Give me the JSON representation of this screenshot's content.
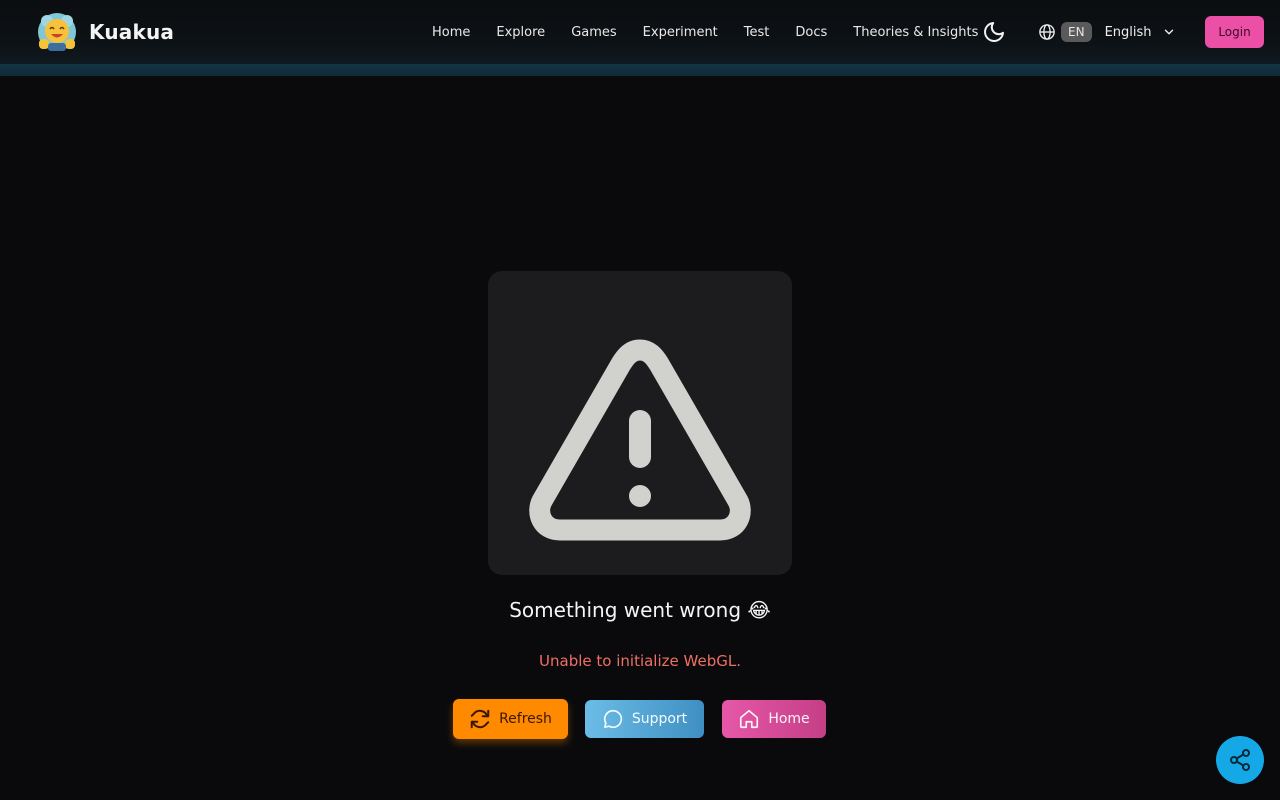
{
  "brand": {
    "name": "Kuakua",
    "logo_icon": "mascot-logo-icon"
  },
  "nav": {
    "items": [
      {
        "label": "Home"
      },
      {
        "label": "Explore"
      },
      {
        "label": "Games"
      },
      {
        "label": "Experiment"
      },
      {
        "label": "Test"
      },
      {
        "label": "Docs"
      },
      {
        "label": "Theories & Insights"
      }
    ]
  },
  "header": {
    "theme_icon": "moon-icon",
    "language": {
      "code": "EN",
      "name": "English",
      "icon": "globe-icon"
    },
    "login_label": "Login"
  },
  "error": {
    "icon": "warning-triangle-icon",
    "title": "Something went wrong 😂",
    "message": "Unable to initialize WebGL."
  },
  "actions": {
    "refresh_label": "Refresh",
    "support_label": "Support",
    "home_label": "Home"
  },
  "share_icon": "share-icon",
  "colors": {
    "background": "#0a0a0c",
    "login": "#ec4fa6",
    "refresh": "#ff8a00",
    "support": "#4fa2d2",
    "home": "#d84a98",
    "error_text": "#ee6f63",
    "share": "#14a8e6"
  }
}
